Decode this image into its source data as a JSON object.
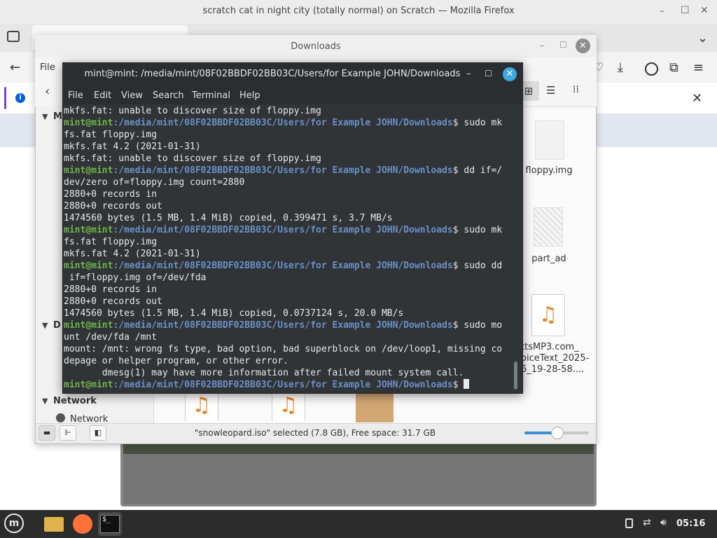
{
  "firefox": {
    "window_title": "scratch cat in night city (totally normal) on Scratch — Mozilla Firefox",
    "controls": {
      "minimize": "–",
      "maximize": "☐",
      "close": "✕"
    },
    "icons": [
      "back-icon",
      "pocket-icon",
      "download-icon",
      "account-icon",
      "extensions-icon",
      "menu-icon",
      "info-icon",
      "close-icon"
    ]
  },
  "file_manager": {
    "title": "Downloads",
    "menu_first": "File",
    "status": "\"snowleopard.iso\" selected (7.8 GB), Free space: 31.7 GB",
    "sidebar": {
      "section_my_computer": "M",
      "section_devices": "D",
      "section_network": "Network",
      "network_item": "Network"
    },
    "files": [
      {
        "label": "floppy.img",
        "kind": "doc"
      },
      {
        "label": "part_ad",
        "kind": "doc"
      },
      {
        "label": "ttsMP3.com_",
        "label2": "oiceText_2025-",
        "label3": "6_19-28-58....",
        "kind": "music"
      }
    ],
    "zoom_fraction": 0.5
  },
  "terminal": {
    "title": "mint@mint: /media/mint/08F02BBDF02BB03C/Users/for Example JOHN/Downloads",
    "menu": [
      "File",
      "Edit",
      "View",
      "Search",
      "Terminal",
      "Help"
    ],
    "prompt_user": "mint@mint",
    "prompt_path": ":/media/mint/08F02BBDF02BB03C/Users/for Example JOHN/Downloads",
    "lines": [
      {
        "t": "out",
        "text": "mkfs.fat: unable to discover size of floppy.img"
      },
      {
        "t": "cmd",
        "text": "$ sudo mk"
      },
      {
        "t": "out",
        "text": "fs.fat floppy.img"
      },
      {
        "t": "out",
        "text": "mkfs.fat 4.2 (2021-01-31)"
      },
      {
        "t": "out",
        "text": "mkfs.fat: unable to discover size of floppy.img"
      },
      {
        "t": "cmd",
        "text": "$ dd if=/"
      },
      {
        "t": "out",
        "text": "dev/zero of=floppy.img count=2880"
      },
      {
        "t": "out",
        "text": "2880+0 records in"
      },
      {
        "t": "out",
        "text": "2880+0 records out"
      },
      {
        "t": "out",
        "text": "1474560 bytes (1.5 MB, 1.4 MiB) copied, 0.399471 s, 3.7 MB/s"
      },
      {
        "t": "cmd",
        "text": "$ sudo mk"
      },
      {
        "t": "out",
        "text": "fs.fat floppy.img"
      },
      {
        "t": "out",
        "text": "mkfs.fat 4.2 (2021-01-31)"
      },
      {
        "t": "cmd",
        "text": "$ sudo dd"
      },
      {
        "t": "out",
        "text": " if=floppy.img of=/dev/fda"
      },
      {
        "t": "out",
        "text": "2880+0 records in"
      },
      {
        "t": "out",
        "text": "2880+0 records out"
      },
      {
        "t": "out",
        "text": "1474560 bytes (1.5 MB, 1.4 MiB) copied, 0.0737124 s, 20.0 MB/s"
      },
      {
        "t": "cmd",
        "text": "$ sudo mo"
      },
      {
        "t": "out",
        "text": "unt /dev/fda /mnt"
      },
      {
        "t": "out",
        "text": "mount: /mnt: wrong fs type, bad option, bad superblock on /dev/loop1, missing co"
      },
      {
        "t": "out",
        "text": "depage or helper program, or other error."
      },
      {
        "t": "out",
        "text": "       dmesg(1) may have more information after failed mount system call."
      },
      {
        "t": "cmd",
        "text": "$ "
      }
    ]
  },
  "taskbar": {
    "clock": "05:16",
    "apps": [
      "mint-menu-icon",
      "files-icon",
      "firefox-icon",
      "terminal-icon"
    ],
    "terminal_glyph": "$_"
  },
  "colors": {
    "terminal_bg": "#303437",
    "prompt_user": "#6fb34b",
    "prompt_path": "#6c8fc4",
    "accent_blue": "#3fa6e0",
    "music_orange": "#e8882a"
  }
}
